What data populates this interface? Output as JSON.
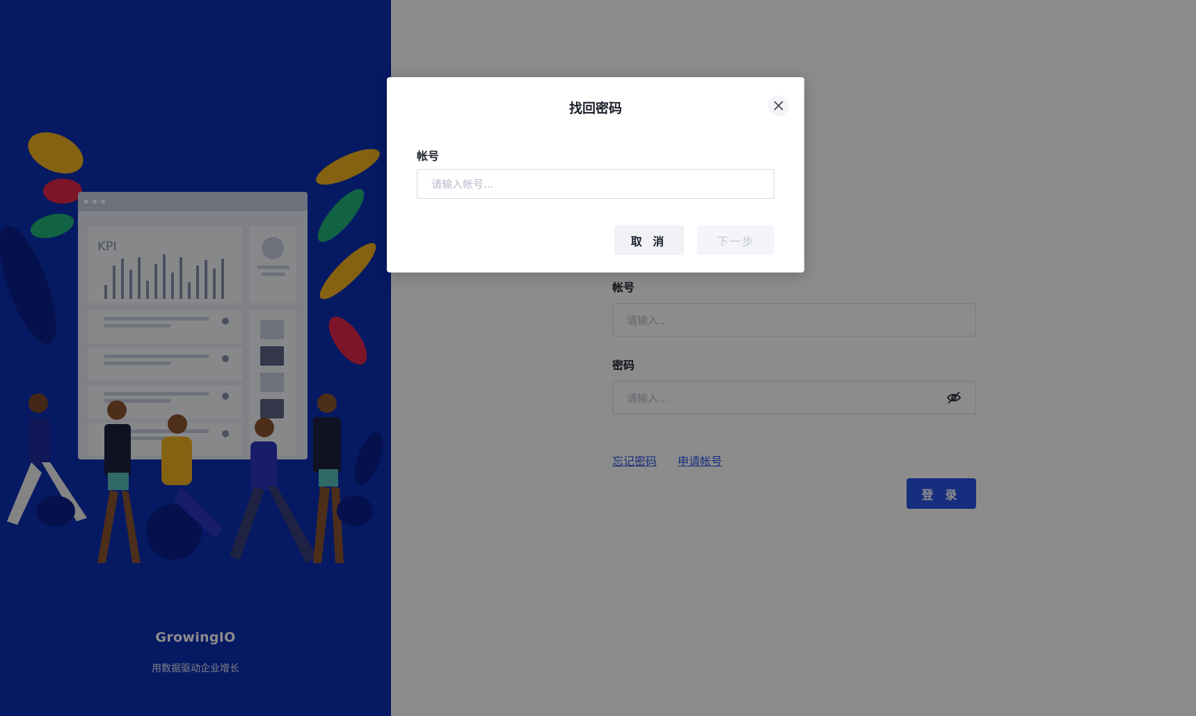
{
  "brand": {
    "name": "GrowingIO",
    "slogan": "用数据驱动企业增长"
  },
  "illustration": {
    "kpi_label": "KPI"
  },
  "login": {
    "account_label": "帐号",
    "account_placeholder": "请输入...",
    "password_label": "密码",
    "password_placeholder": "请输入...",
    "forgot_link": "忘记密码",
    "apply_link": "申请帐号",
    "login_button": "登 录"
  },
  "modal": {
    "title": "找回密码",
    "account_label": "帐号",
    "account_placeholder": "请输入帐号...",
    "cancel_button": "取 消",
    "next_button": "下一步"
  },
  "colors": {
    "brand_blue": "#0b2fb5",
    "primary": "#2a55e5"
  },
  "icons": {
    "close": "close-icon",
    "eye": "eye-off-icon"
  }
}
